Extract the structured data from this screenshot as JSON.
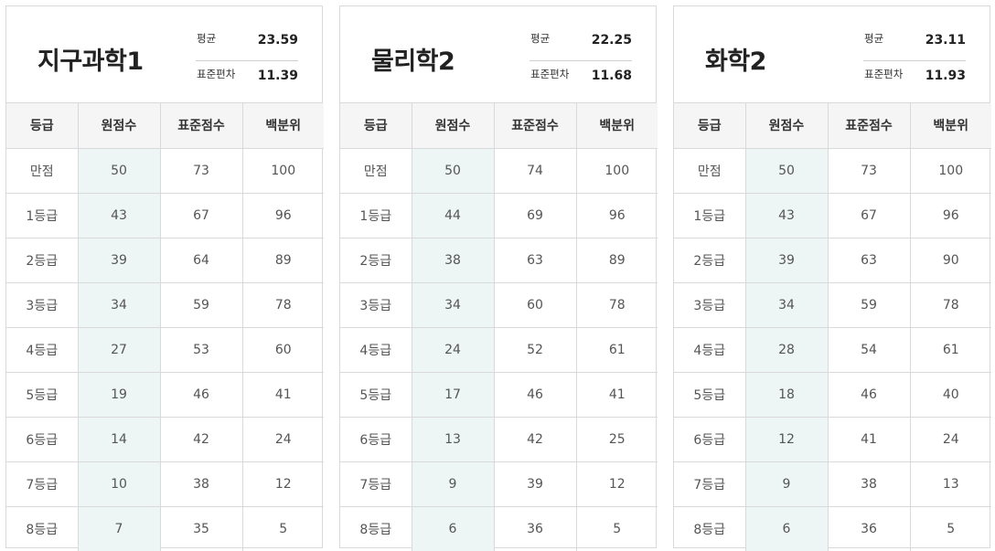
{
  "columns": [
    "등급",
    "원점수",
    "표준점수",
    "백분위"
  ],
  "stat_labels": {
    "mean": "평균",
    "std": "표준편차"
  },
  "panels": [
    {
      "title": "지구과학1",
      "mean": "23.59",
      "std": "11.39",
      "rows": [
        {
          "grade": "만점",
          "raw": "50",
          "standard": "73",
          "percentile": "100"
        },
        {
          "grade": "1등급",
          "raw": "43",
          "standard": "67",
          "percentile": "96"
        },
        {
          "grade": "2등급",
          "raw": "39",
          "standard": "64",
          "percentile": "89"
        },
        {
          "grade": "3등급",
          "raw": "34",
          "standard": "59",
          "percentile": "78"
        },
        {
          "grade": "4등급",
          "raw": "27",
          "standard": "53",
          "percentile": "60"
        },
        {
          "grade": "5등급",
          "raw": "19",
          "standard": "46",
          "percentile": "41"
        },
        {
          "grade": "6등급",
          "raw": "14",
          "standard": "42",
          "percentile": "24"
        },
        {
          "grade": "7등급",
          "raw": "10",
          "standard": "38",
          "percentile": "12"
        },
        {
          "grade": "8등급",
          "raw": "7",
          "standard": "35",
          "percentile": "5"
        }
      ]
    },
    {
      "title": "물리학2",
      "mean": "22.25",
      "std": "11.68",
      "rows": [
        {
          "grade": "만점",
          "raw": "50",
          "standard": "74",
          "percentile": "100"
        },
        {
          "grade": "1등급",
          "raw": "44",
          "standard": "69",
          "percentile": "96"
        },
        {
          "grade": "2등급",
          "raw": "38",
          "standard": "63",
          "percentile": "89"
        },
        {
          "grade": "3등급",
          "raw": "34",
          "standard": "60",
          "percentile": "78"
        },
        {
          "grade": "4등급",
          "raw": "24",
          "standard": "52",
          "percentile": "61"
        },
        {
          "grade": "5등급",
          "raw": "17",
          "standard": "46",
          "percentile": "41"
        },
        {
          "grade": "6등급",
          "raw": "13",
          "standard": "42",
          "percentile": "25"
        },
        {
          "grade": "7등급",
          "raw": "9",
          "standard": "39",
          "percentile": "12"
        },
        {
          "grade": "8등급",
          "raw": "6",
          "standard": "36",
          "percentile": "5"
        }
      ]
    },
    {
      "title": "화학2",
      "mean": "23.11",
      "std": "11.93",
      "rows": [
        {
          "grade": "만점",
          "raw": "50",
          "standard": "73",
          "percentile": "100"
        },
        {
          "grade": "1등급",
          "raw": "43",
          "standard": "67",
          "percentile": "96"
        },
        {
          "grade": "2등급",
          "raw": "39",
          "standard": "63",
          "percentile": "90"
        },
        {
          "grade": "3등급",
          "raw": "34",
          "standard": "59",
          "percentile": "78"
        },
        {
          "grade": "4등급",
          "raw": "28",
          "standard": "54",
          "percentile": "61"
        },
        {
          "grade": "5등급",
          "raw": "18",
          "standard": "46",
          "percentile": "40"
        },
        {
          "grade": "6등급",
          "raw": "12",
          "standard": "41",
          "percentile": "24"
        },
        {
          "grade": "7등급",
          "raw": "9",
          "standard": "38",
          "percentile": "13"
        },
        {
          "grade": "8등급",
          "raw": "6",
          "standard": "36",
          "percentile": "5"
        }
      ]
    }
  ]
}
